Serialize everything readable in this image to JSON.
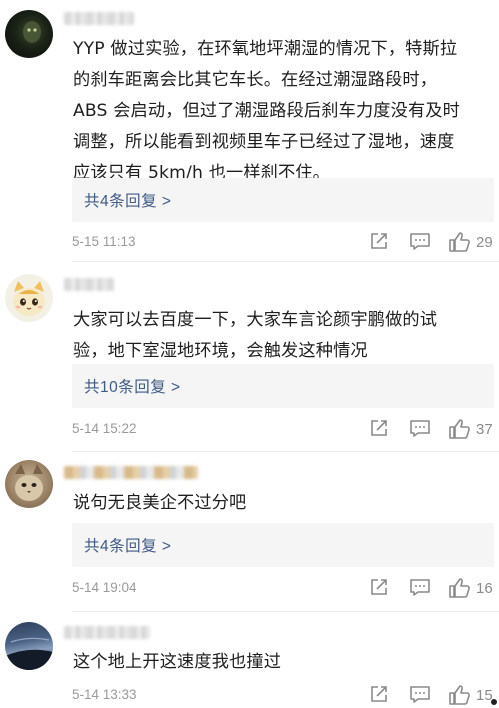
{
  "comments": [
    {
      "text_lines": [
        "YYP 做过实验，在环氧地坪潮湿的情况下，特斯拉",
        "的刹车距离会比其它车长。在经过潮湿路段时，",
        "ABS 会启动，但过了潮湿路段后刹车力度没有及时",
        "调整，所以能看到视频里车子已经过了湿地，速度",
        "应该只有 5km/h 也一样刹不住。"
      ],
      "reply_label": "共4条回复 >",
      "time": "5-15 11:13",
      "likes": "29"
    },
    {
      "text_lines": [
        "大家可以去百度一下，大家车言论颜宇鹏做的试",
        "验，地下室湿地环境，会触发这种情况"
      ],
      "reply_label": "共10条回复 >",
      "time": "5-14 15:22",
      "likes": "37"
    },
    {
      "text_lines": [
        "说句无良美企不过分吧"
      ],
      "reply_label": "共4条回复 >",
      "time": "5-14 19:04",
      "likes": "16"
    },
    {
      "text_lines": [
        "这个地上开这速度我也撞过"
      ],
      "time": "5-14 13:33",
      "likes": "15"
    }
  ],
  "icons": {
    "share": "share-icon",
    "comment": "comment-icon",
    "like": "thumbs-up-icon"
  },
  "colors": {
    "link": "#3f5a86",
    "meta_gray": "#9a9a9a",
    "reply_bg": "#f5f5f5"
  }
}
